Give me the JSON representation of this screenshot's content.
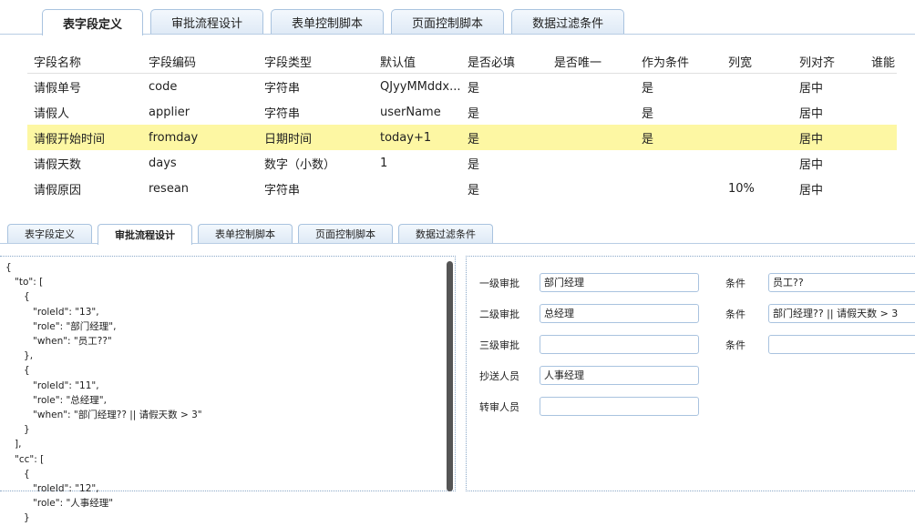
{
  "top_tabs": [
    "表字段定义",
    "审批流程设计",
    "表单控制脚本",
    "页面控制脚本",
    "数据过滤条件"
  ],
  "top_active": 0,
  "grid": {
    "columns": [
      "字段名称",
      "字段编码",
      "字段类型",
      "默认值",
      "是否必填",
      "是否唯一",
      "作为条件",
      "列宽",
      "列对齐",
      "谁能"
    ],
    "rows": [
      [
        "请假单号",
        "code",
        "字符串",
        "QJyyMMddx...",
        "是",
        "",
        "是",
        "",
        "居中",
        ""
      ],
      [
        "请假人",
        "applier",
        "字符串",
        "userName",
        "是",
        "",
        "是",
        "",
        "居中",
        ""
      ],
      [
        "请假开始时间",
        "fromday",
        "日期时间",
        "today+1",
        "是",
        "",
        "是",
        "",
        "居中",
        ""
      ],
      [
        "请假天数",
        "days",
        "数字（小数）",
        "1",
        "是",
        "",
        "",
        "",
        "居中",
        ""
      ],
      [
        "请假原因",
        "resean",
        "字符串",
        "",
        "是",
        "",
        "",
        "10%",
        "居中",
        ""
      ]
    ],
    "highlighted_row": 2
  },
  "bottom_tabs": [
    "表字段定义",
    "审批流程设计",
    "表单控制脚本",
    "页面控制脚本",
    "数据过滤条件"
  ],
  "bottom_active": 1,
  "json_text": "{\n   \"to\": [\n      {\n         \"roleId\": \"13\",\n         \"role\": \"部门经理\",\n         \"when\": \"员工??\"\n      },\n      {\n         \"roleId\": \"11\",\n         \"role\": \"总经理\",\n         \"when\": \"部门经理?? || 请假天数 > 3\"\n      }\n   ],\n   \"cc\": [\n      {\n         \"roleId\": \"12\",\n         \"role\": \"人事经理\"\n      }",
  "form": {
    "level1_label": "一级审批",
    "level1_value": "部门经理",
    "level2_label": "二级审批",
    "level2_value": "总经理",
    "level3_label": "三级审批",
    "level3_value": "",
    "cc_label": "抄送人员",
    "cc_value": "人事经理",
    "transfer_label": "转审人员",
    "transfer_value": "",
    "cond_label": "条件",
    "cond1_value": "员工??",
    "cond2_value": "部门经理?? || 请假天数 > 3",
    "cond3_value": ""
  }
}
